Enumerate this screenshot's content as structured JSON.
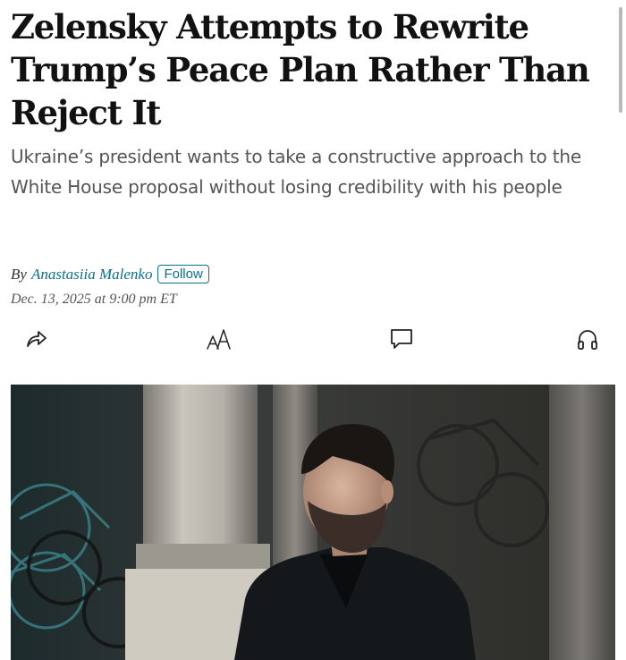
{
  "article": {
    "headline": "Zelensky Attempts to Rewrite Trump’s Peace Plan Rather Than Reject It",
    "dek": "Ukraine’s president wants to take a constructive approach to the White House proposal without losing credibility with his people",
    "byline_prefix": "By",
    "author": "Anastasiia Malenko",
    "follow_label": "Follow",
    "date": "Dec. 13, 2025 at 9:00 pm ET"
  },
  "toolbar": {
    "share_icon": "share-arrow-icon",
    "text_size_icon": "text-size-icon",
    "text_size_glyph": "AA",
    "comments_icon": "comment-bubble-icon",
    "listen_icon": "headphones-icon"
  },
  "photo": {
    "subject": "man-in-dark-coat-portrait"
  },
  "colors": {
    "link": "#0a6f8a",
    "headline": "#111111",
    "dek": "#555555"
  }
}
